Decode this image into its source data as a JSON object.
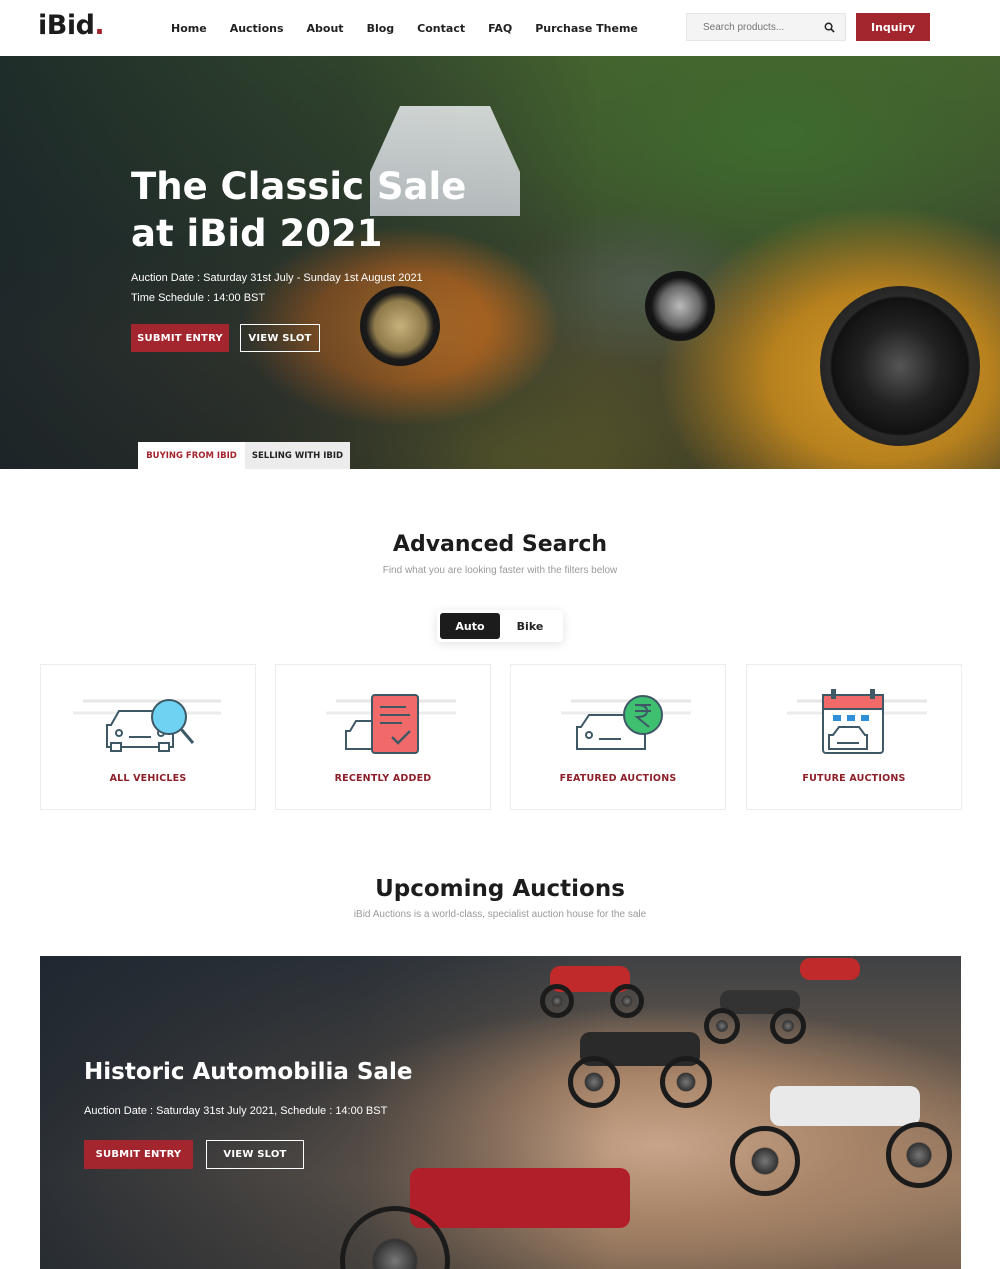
{
  "header": {
    "logo": "iBid",
    "logo_dot": ".",
    "nav": [
      "Home",
      "Auctions",
      "About",
      "Blog",
      "Contact",
      "FAQ",
      "Purchase Theme"
    ],
    "search_placeholder": "Search products...",
    "inquiry_label": "Inquiry"
  },
  "hero": {
    "title": "The Classic Sale at iBid 2021",
    "auction_date": "Auction Date : Saturday 31st July - Sunday 1st August 2021",
    "time_schedule": "Time Schedule : 14:00 BST",
    "submit_label": "SUBMIT ENTRY",
    "view_label": "VIEW SLOT",
    "tabs": [
      "BUYING FROM IBID",
      "SELLING WITH IBID"
    ]
  },
  "advanced_search": {
    "title": "Advanced Search",
    "subtitle": "Find what you are looking faster with the filters below",
    "toggle": [
      "Auto",
      "Bike"
    ],
    "categories": [
      {
        "label": "ALL VEHICLES",
        "icon": "car-magnifier-icon"
      },
      {
        "label": "RECENTLY ADDED",
        "icon": "car-checklist-icon"
      },
      {
        "label": "FEATURED AUCTIONS",
        "icon": "car-rupee-icon"
      },
      {
        "label": "FUTURE AUCTIONS",
        "icon": "car-calendar-icon"
      }
    ]
  },
  "upcoming": {
    "title": "Upcoming Auctions",
    "subtitle": "iBid Auctions is a world-class, specialist auction house for the sale",
    "banner": {
      "title": "Historic Automobilia Sale",
      "date": "Auction Date : Saturday 31st July 2021, Schedule : 14:00 BST",
      "submit_label": "SUBMIT ENTRY",
      "view_label": "VIEW SLOT"
    }
  },
  "colors": {
    "accent": "#a3262e",
    "dark": "#1c1c1c",
    "icon_teal": "#3e5866",
    "icon_red": "#f06a6a",
    "icon_green": "#3fbf70",
    "icon_blue": "#2f8fd8"
  }
}
